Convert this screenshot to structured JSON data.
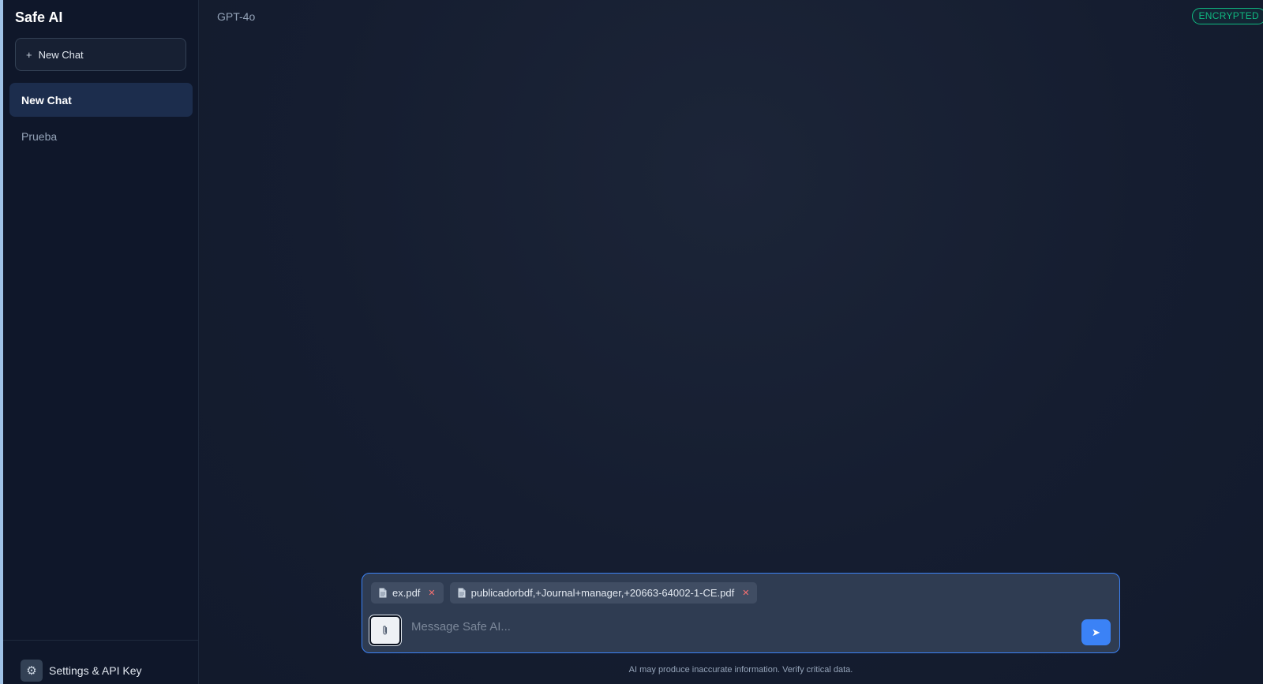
{
  "sidebar": {
    "brand": "Safe AI",
    "new_chat_label": "New Chat",
    "new_chat_icon": "+",
    "chats": [
      {
        "label": "New Chat",
        "active": true
      },
      {
        "label": "Prueba",
        "active": false
      }
    ],
    "settings_label": "Settings & API Key",
    "settings_icon": "gear-icon"
  },
  "header": {
    "model": "GPT-4o",
    "badge": "ENCRYPTED"
  },
  "composer": {
    "attachments": [
      {
        "name": "ex.pdf"
      },
      {
        "name": "publicadorbdf,+Journal+manager,+20663-64002-1-CE.pdf"
      }
    ],
    "placeholder": "Message Safe AI...",
    "attach_icon": "paperclip-icon",
    "send_icon": "send-icon"
  },
  "footer": {
    "disclaimer": "AI may produce inaccurate information. Verify critical data."
  },
  "colors": {
    "accent": "#3b82f6",
    "encrypted": "#10b981",
    "remove": "#f87171"
  }
}
